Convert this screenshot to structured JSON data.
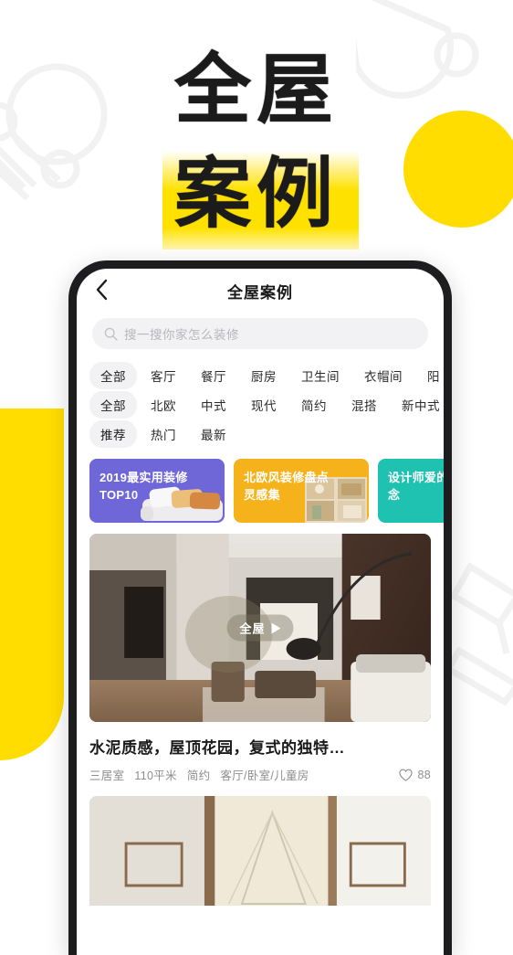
{
  "hero": {
    "line1": "全屋",
    "line2": "案例"
  },
  "phone": {
    "navbar": {
      "back_icon": "chevron-left-icon",
      "title": "全屋案例"
    },
    "search": {
      "icon": "search-icon",
      "placeholder": "搜一搜你家怎么装修"
    },
    "filter_rows": [
      {
        "name": "space-filter",
        "chips": [
          "全部",
          "客厅",
          "餐厅",
          "厨房",
          "卫生间",
          "衣帽间",
          "阳"
        ],
        "active": 0
      },
      {
        "name": "style-filter",
        "chips": [
          "全部",
          "北欧",
          "中式",
          "现代",
          "简约",
          "混搭",
          "新中式"
        ],
        "active": 0
      },
      {
        "name": "sort-filter",
        "chips": [
          "推荐",
          "热门",
          "最新"
        ],
        "active": 0
      }
    ],
    "banners": [
      {
        "text": "2019最实用装修TOP10",
        "color": "#6f66d8",
        "art": "sofa"
      },
      {
        "text": "北欧风装修盘点灵感集",
        "color": "#f6b21b",
        "art": "shelf"
      },
      {
        "text": "设计师爱的小概念",
        "color": "#1fc2b0",
        "art": "armchair"
      }
    ],
    "card": {
      "badge_text": "全屋",
      "badge_icon": "play-icon",
      "title": "水泥质感，屋顶花园，复式的独特…",
      "meta": [
        "三居室",
        "110平米",
        "简约",
        "客厅/卧室/儿童房"
      ],
      "like_icon": "heart-icon",
      "like_count": "88"
    }
  },
  "colors": {
    "accent_yellow": "#ffdd00",
    "title_band": "#ffe100",
    "phone_frame": "#1d1d1f",
    "banner_purple": "#6f66d8",
    "banner_yellow": "#f6b21b",
    "banner_teal": "#1fc2b0"
  }
}
